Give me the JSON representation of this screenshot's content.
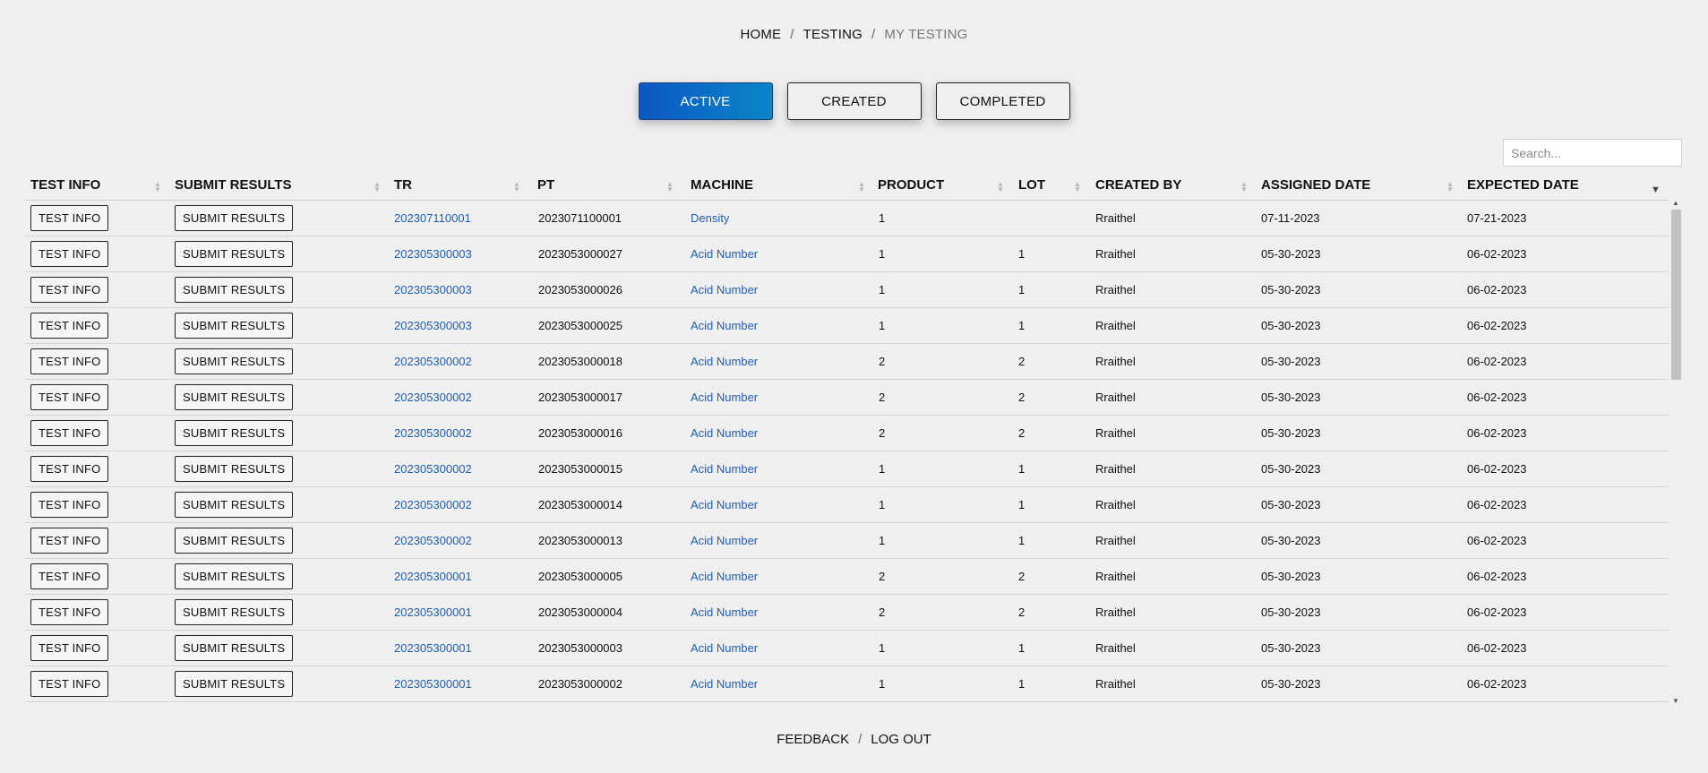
{
  "breadcrumb": {
    "home": "HOME",
    "testing": "TESTING",
    "current": "MY TESTING",
    "separator": "/"
  },
  "tabs": {
    "active": "ACTIVE",
    "created": "CREATED",
    "completed": "COMPLETED"
  },
  "search": {
    "placeholder": "Search..."
  },
  "table": {
    "headers": {
      "test_info": "TEST INFO",
      "submit_results": "SUBMIT RESULTS",
      "tr": "TR",
      "pt": "PT",
      "machine": "MACHINE",
      "product": "PRODUCT",
      "lot": "LOT",
      "created_by": "CREATED BY",
      "assigned_date": "ASSIGNED DATE",
      "expected_date": "EXPECTED DATE"
    },
    "sorted_column": "EXPECTED DATE",
    "sort_direction": "descending",
    "button_labels": {
      "test_info": "TEST INFO",
      "submit_results": "SUBMIT RESULTS"
    },
    "rows": [
      {
        "tr": "202307110001",
        "pt": "2023071100001",
        "machine": "Density",
        "product": "1",
        "lot": "",
        "created_by": "Rraithel",
        "assigned_date": "07-11-2023",
        "expected_date": "07-21-2023"
      },
      {
        "tr": "202305300003",
        "pt": "2023053000027",
        "machine": "Acid Number",
        "product": "1",
        "lot": "1",
        "created_by": "Rraithel",
        "assigned_date": "05-30-2023",
        "expected_date": "06-02-2023"
      },
      {
        "tr": "202305300003",
        "pt": "2023053000026",
        "machine": "Acid Number",
        "product": "1",
        "lot": "1",
        "created_by": "Rraithel",
        "assigned_date": "05-30-2023",
        "expected_date": "06-02-2023"
      },
      {
        "tr": "202305300003",
        "pt": "2023053000025",
        "machine": "Acid Number",
        "product": "1",
        "lot": "1",
        "created_by": "Rraithel",
        "assigned_date": "05-30-2023",
        "expected_date": "06-02-2023"
      },
      {
        "tr": "202305300002",
        "pt": "2023053000018",
        "machine": "Acid Number",
        "product": "2",
        "lot": "2",
        "created_by": "Rraithel",
        "assigned_date": "05-30-2023",
        "expected_date": "06-02-2023"
      },
      {
        "tr": "202305300002",
        "pt": "2023053000017",
        "machine": "Acid Number",
        "product": "2",
        "lot": "2",
        "created_by": "Rraithel",
        "assigned_date": "05-30-2023",
        "expected_date": "06-02-2023"
      },
      {
        "tr": "202305300002",
        "pt": "2023053000016",
        "machine": "Acid Number",
        "product": "2",
        "lot": "2",
        "created_by": "Rraithel",
        "assigned_date": "05-30-2023",
        "expected_date": "06-02-2023"
      },
      {
        "tr": "202305300002",
        "pt": "2023053000015",
        "machine": "Acid Number",
        "product": "1",
        "lot": "1",
        "created_by": "Rraithel",
        "assigned_date": "05-30-2023",
        "expected_date": "06-02-2023"
      },
      {
        "tr": "202305300002",
        "pt": "2023053000014",
        "machine": "Acid Number",
        "product": "1",
        "lot": "1",
        "created_by": "Rraithel",
        "assigned_date": "05-30-2023",
        "expected_date": "06-02-2023"
      },
      {
        "tr": "202305300002",
        "pt": "2023053000013",
        "machine": "Acid Number",
        "product": "1",
        "lot": "1",
        "created_by": "Rraithel",
        "assigned_date": "05-30-2023",
        "expected_date": "06-02-2023"
      },
      {
        "tr": "202305300001",
        "pt": "2023053000005",
        "machine": "Acid Number",
        "product": "2",
        "lot": "2",
        "created_by": "Rraithel",
        "assigned_date": "05-30-2023",
        "expected_date": "06-02-2023"
      },
      {
        "tr": "202305300001",
        "pt": "2023053000004",
        "machine": "Acid Number",
        "product": "2",
        "lot": "2",
        "created_by": "Rraithel",
        "assigned_date": "05-30-2023",
        "expected_date": "06-02-2023"
      },
      {
        "tr": "202305300001",
        "pt": "2023053000003",
        "machine": "Acid Number",
        "product": "1",
        "lot": "1",
        "created_by": "Rraithel",
        "assigned_date": "05-30-2023",
        "expected_date": "06-02-2023"
      },
      {
        "tr": "202305300001",
        "pt": "2023053000002",
        "machine": "Acid Number",
        "product": "1",
        "lot": "1",
        "created_by": "Rraithel",
        "assigned_date": "05-30-2023",
        "expected_date": "06-02-2023"
      }
    ]
  },
  "footer": {
    "feedback": "FEEDBACK",
    "logout": "LOG OUT",
    "separator": "/"
  },
  "colors": {
    "accent_gradient_start": "#0d57c2",
    "accent_gradient_end": "#0a86c8",
    "link": "#1d5fb4",
    "background": "#efefef"
  }
}
